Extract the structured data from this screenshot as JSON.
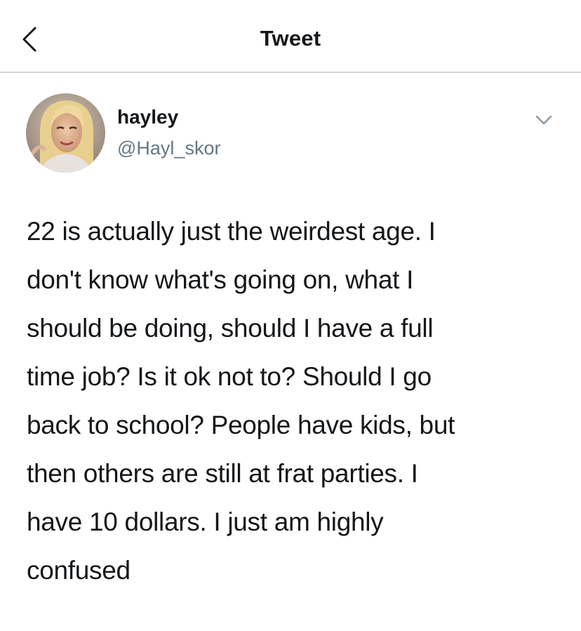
{
  "header": {
    "title": "Tweet",
    "back_icon": "chevron-left-icon"
  },
  "author": {
    "display_name": "hayley",
    "handle": "@Hayl_skor",
    "avatar_icon": "profile-photo",
    "menu_icon": "chevron-down-icon"
  },
  "tweet": {
    "lines": [
      "22 is actually just the weirdest age. I",
      "don't know what's going on, what I",
      "should be doing, should I have a full",
      "time job? Is it ok not to? Should I go",
      "back to school? People have kids, but",
      "then others are still at frat parties. I",
      "have 10 dollars. I just am highly",
      "confused"
    ]
  },
  "colors": {
    "text": "#14171a",
    "secondary_text": "#657786",
    "divider": "#cfd4d8",
    "background": "#ffffff"
  }
}
